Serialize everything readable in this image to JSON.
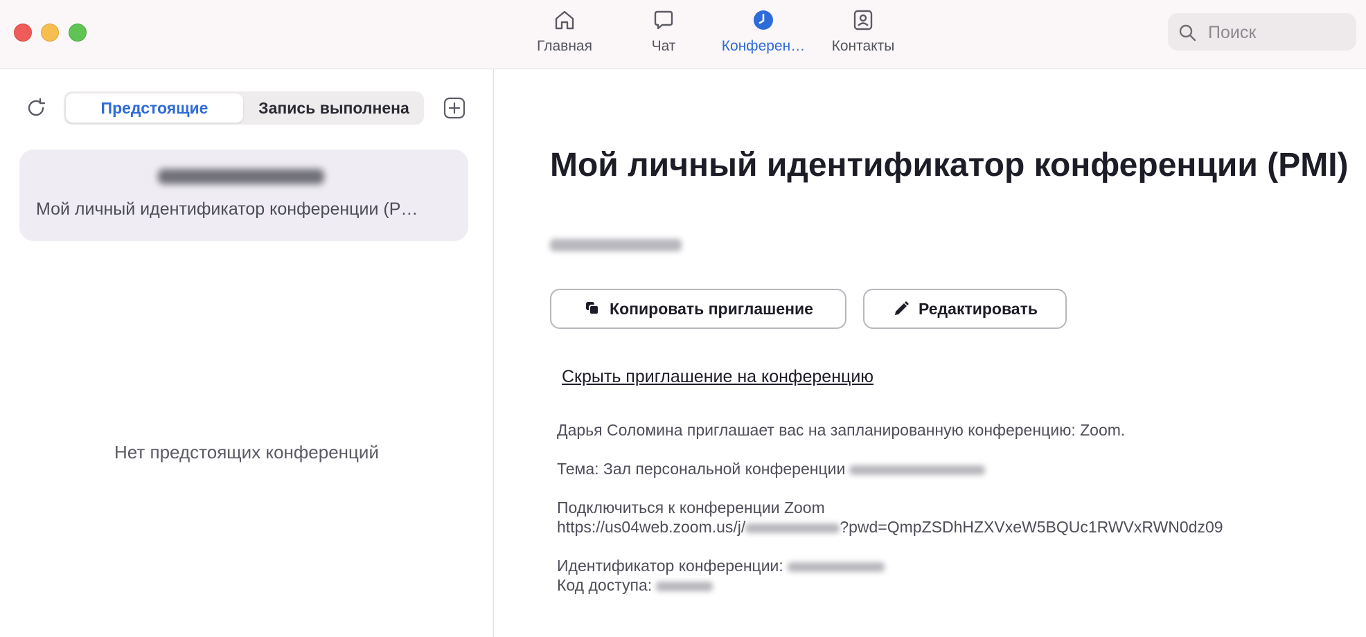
{
  "window": {
    "traffic_lights": [
      "close",
      "minimize",
      "maximize"
    ]
  },
  "nav": {
    "tabs": [
      {
        "label": "Главная",
        "icon": "home-icon",
        "active": false
      },
      {
        "label": "Чат",
        "icon": "chat-bubble-icon",
        "active": false
      },
      {
        "label": "Конферен…",
        "icon": "clock-icon",
        "active": true
      },
      {
        "label": "Контакты",
        "icon": "contact-card-icon",
        "active": false
      }
    ],
    "active_color": "#2d6bd9"
  },
  "search": {
    "placeholder": "Поиск",
    "value": ""
  },
  "sidebar": {
    "segments": [
      "Предстоящие",
      "Запись выполнена"
    ],
    "active_segment": "Предстоящие",
    "pmi_card": {
      "meeting_id": "[blurred]",
      "title": "Мой личный идентификатор конференции (P…"
    },
    "empty_text": "Нет предстоящих конференций"
  },
  "detail": {
    "title": "Мой личный идентификатор конференции (PMI)",
    "pmi_value": "[blurred]",
    "copy_invite_label": "Копировать приглашение",
    "edit_label": "Редактировать",
    "hide_invite_link": "Скрыть приглашение на конференцию",
    "invite": {
      "line1": "Дарья Соломина приглашает вас на запланированную конференцию: Zoom.",
      "topic_label": "Тема: Зал персональной конференции",
      "join_label": "Подключиться к конференции Zoom",
      "url_prefix": "https://us04web.zoom.us/j/",
      "url_suffix": "?pwd=QmpZSDhHZXVxeW5BQUc1RWVxRWN0dz09",
      "meeting_id_label": "Идентификатор конференции:",
      "passcode_label": "Код доступа:"
    }
  }
}
